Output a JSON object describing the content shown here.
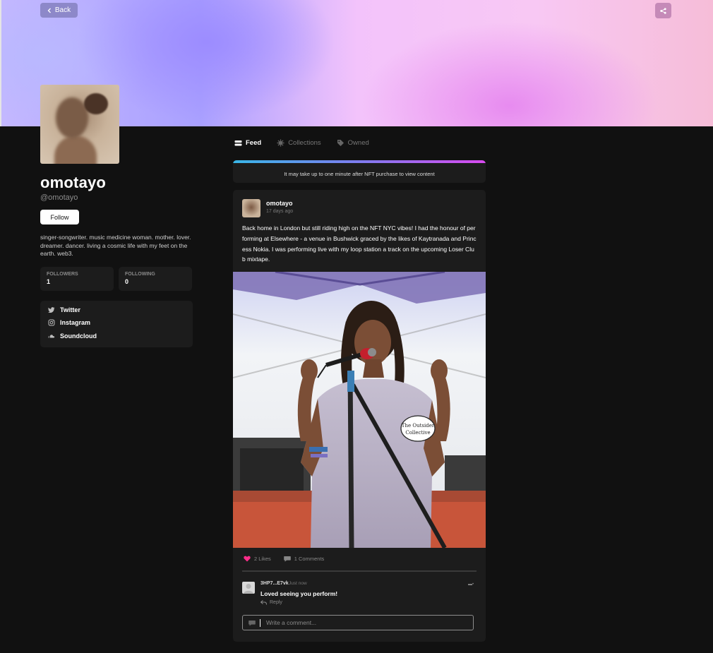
{
  "header": {
    "back_label": "Back",
    "share_icon": "share-icon"
  },
  "profile": {
    "name": "omotayo",
    "handle": "@omotayo",
    "follow_label": "Follow",
    "bio": "singer-songwriter. music medicine woman. mother. lover. dreamer. dancer. living a cosmic life with my feet on the earth. web3.",
    "stats": [
      {
        "label": "FOLLOWERS",
        "value": "1"
      },
      {
        "label": "FOLLOWING",
        "value": "0"
      }
    ],
    "socials": [
      {
        "label": "Twitter",
        "icon": "twitter-icon"
      },
      {
        "label": "Instagram",
        "icon": "instagram-icon"
      },
      {
        "label": "Soundcloud",
        "icon": "soundcloud-icon"
      }
    ]
  },
  "tabs": [
    {
      "label": "Feed",
      "icon": "feed-icon",
      "active": true
    },
    {
      "label": "Collections",
      "icon": "collections-icon",
      "active": false
    },
    {
      "label": "Owned",
      "icon": "tag-icon",
      "active": false
    }
  ],
  "notice": {
    "text": "It may take up to one minute after NFT purchase to view content",
    "gradient": [
      "#39b6e8",
      "#7f7cf0",
      "#d94af0"
    ]
  },
  "post": {
    "author": "omotayo",
    "time": "17 days ago",
    "text": "Back home in London but still riding high on the NFT NYC vibes! I had the honour of performing at Elsewhere - a venue in Bushwick graced by the likes of Kaytranada and Princess Nokia. I was performing live with my loop station a track on the upcoming Loser Club mixtape.",
    "likes": "2 Likes",
    "comments_count": "1 Comments",
    "like_color": "#ff2d8a"
  },
  "comment": {
    "user": "3HP7...E7vk",
    "time": "Just now",
    "text": "Loved seeing you perform!",
    "reply_label": "Reply",
    "menu": "▬•"
  },
  "comment_input": {
    "placeholder": "Write a comment..."
  }
}
